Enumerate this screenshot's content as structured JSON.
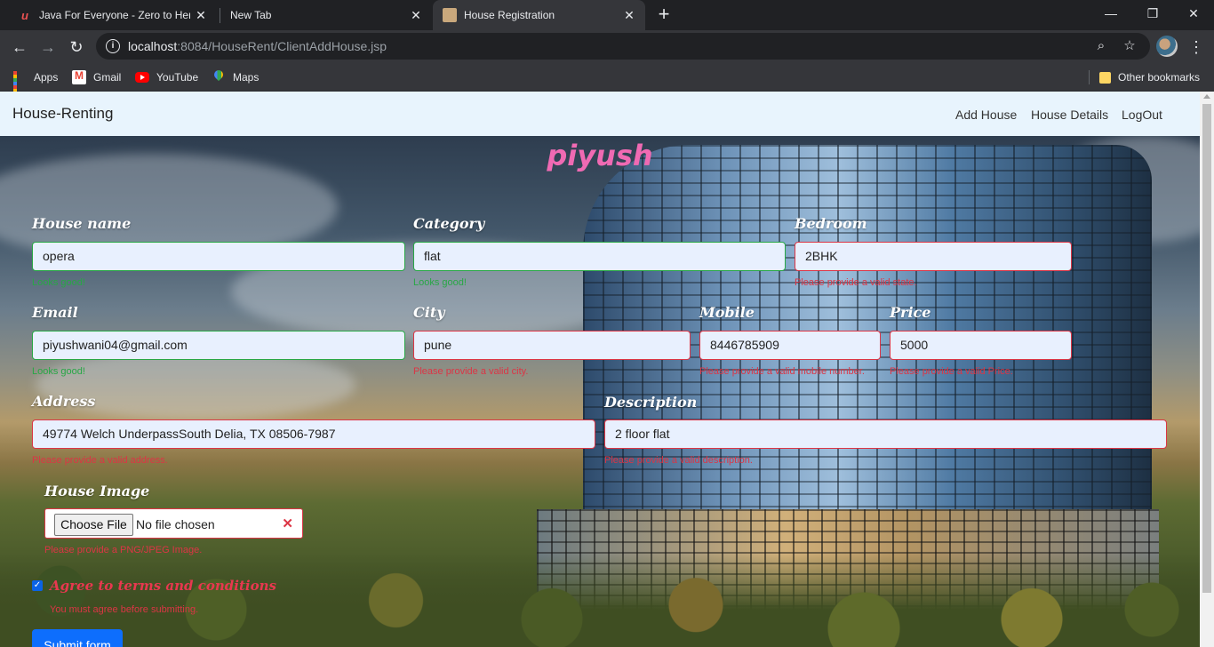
{
  "browser": {
    "tabs": [
      {
        "title": "Java For Everyone - Zero to Hero",
        "active": false
      },
      {
        "title": "New Tab",
        "active": false
      },
      {
        "title": "House Registration",
        "active": true
      }
    ],
    "url_host": "localhost",
    "url_rest": ":8084/HouseRent/ClientAddHouse.jsp",
    "bookmarks": [
      "Apps",
      "Gmail",
      "YouTube",
      "Maps"
    ],
    "other_bookmarks": "Other bookmarks"
  },
  "navbar": {
    "brand": "House-Renting",
    "links": [
      "Add House",
      "House Details",
      "LogOut"
    ]
  },
  "form": {
    "title": "piyush",
    "house_name": {
      "label": "House name",
      "value": "opera",
      "feedback": "Looks good!"
    },
    "category": {
      "label": "Category",
      "value": "flat",
      "feedback": "Looks good!"
    },
    "bedroom": {
      "label": "Bedroom",
      "value": "2BHK",
      "feedback": "Please provide a valid state."
    },
    "email": {
      "label": "Email",
      "value": "piyushwani04@gmail.com",
      "feedback": "Looks good!"
    },
    "city": {
      "label": "City",
      "value": "pune",
      "feedback": "Please provide a valid city."
    },
    "mobile": {
      "label": "Mobile",
      "value": "8446785909",
      "feedback": "Please provide a valid mobile number."
    },
    "price": {
      "label": "Price",
      "value": "5000",
      "feedback": "Please provide a valid Price."
    },
    "address": {
      "label": "Address",
      "value": "49774 Welch UnderpassSouth Delia, TX 08506-7987",
      "feedback": "Please provide a valid address."
    },
    "description": {
      "label": "Description",
      "value": "2 floor flat",
      "feedback": "Please provide a valid description."
    },
    "image": {
      "label": "House Image",
      "button": "Choose File",
      "status": "No file chosen",
      "feedback": "Please provide a PNG/JPEG Image."
    },
    "terms": {
      "label": "Agree to terms and conditions",
      "checked": true,
      "feedback": "You must agree before submitting."
    },
    "submit": "Submit form"
  },
  "colors": {
    "valid": "#28a745",
    "invalid": "#dc3545",
    "title": "#f06ab3",
    "primary": "#0d6efd"
  }
}
